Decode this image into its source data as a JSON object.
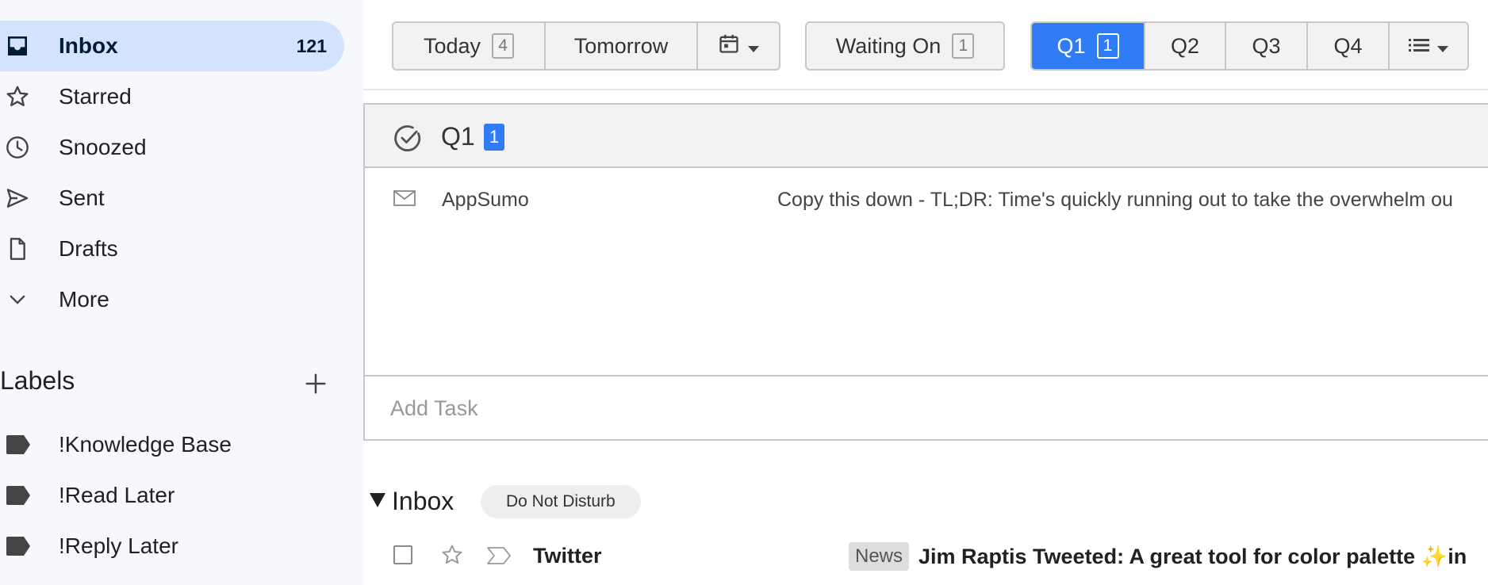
{
  "sidebar": {
    "nav": [
      {
        "label": "Inbox",
        "count": "121",
        "icon": "inbox-icon"
      },
      {
        "label": "Starred",
        "icon": "star-icon"
      },
      {
        "label": "Snoozed",
        "icon": "clock-icon"
      },
      {
        "label": "Sent",
        "icon": "send-icon"
      },
      {
        "label": "Drafts",
        "icon": "draft-icon"
      },
      {
        "label": "More",
        "icon": "chevron-down-icon"
      }
    ],
    "labels_title": "Labels",
    "labels": [
      {
        "label": "!Knowledge Base",
        "icon": "label-icon"
      },
      {
        "label": "!Read Later",
        "icon": "label-icon"
      },
      {
        "label": "!Reply Later",
        "icon": "label-icon"
      }
    ]
  },
  "toolbar": {
    "today_label": "Today",
    "today_count": "4",
    "tomorrow_label": "Tomorrow",
    "calendar_icon": "calendar-icon",
    "waiting_label": "Waiting On",
    "waiting_count": "1",
    "q1_label": "Q1",
    "q1_count": "1",
    "q2_label": "Q2",
    "q3_label": "Q3",
    "q4_label": "Q4",
    "list_icon": "list-icon"
  },
  "panel": {
    "title": "Q1",
    "count": "1",
    "tasks": [
      {
        "sender": "AppSumo",
        "subject": "Copy this down - TL;DR: Time's quickly running out to take the overwhelm ou"
      }
    ],
    "add_task_placeholder": "Add Task"
  },
  "inbox_section": {
    "title": "Inbox",
    "chip": "Do Not Disturb",
    "rows": [
      {
        "sender": "Twitter",
        "tag": "News",
        "subject": "Jim Raptis Tweeted: A great tool for color palette ✨in"
      }
    ]
  },
  "colors": {
    "sidebar_bg": "#f6f8fc",
    "active_nav": "#d3e3fd",
    "accent": "#2f7cf6"
  }
}
